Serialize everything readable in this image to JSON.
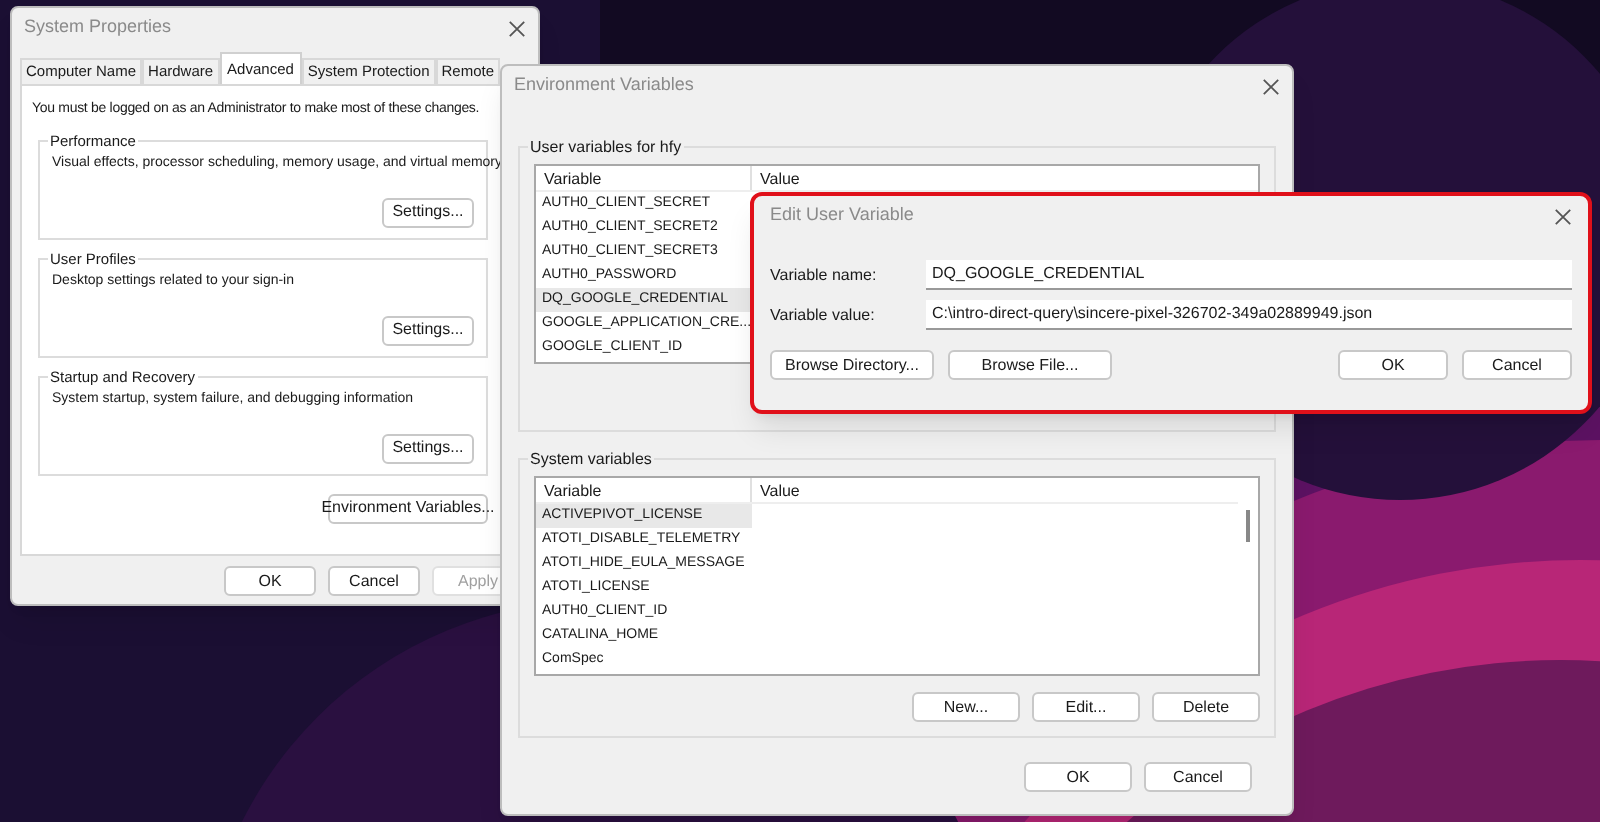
{
  "system_properties": {
    "title": "System Properties",
    "tabs": [
      {
        "label": "Computer Name",
        "selected": false
      },
      {
        "label": "Hardware",
        "selected": false
      },
      {
        "label": "Advanced",
        "selected": true
      },
      {
        "label": "System Protection",
        "selected": false
      },
      {
        "label": "Remote",
        "selected": false
      }
    ],
    "notice": "You must be logged on as an Administrator to make most of these changes.",
    "groups": [
      {
        "title": "Performance",
        "description": "Visual effects, processor scheduling, memory usage, and virtual memory",
        "button": "Settings..."
      },
      {
        "title": "User Profiles",
        "description": "Desktop settings related to your sign-in",
        "button": "Settings..."
      },
      {
        "title": "Startup and Recovery",
        "description": "System startup, system failure, and debugging information",
        "button": "Settings..."
      }
    ],
    "env_button": "Environment Variables...",
    "buttons": [
      {
        "label": "OK",
        "disabled": false
      },
      {
        "label": "Cancel",
        "disabled": false
      },
      {
        "label": "Apply",
        "disabled": true
      }
    ]
  },
  "environment_variables": {
    "title": "Environment Variables",
    "user_section": {
      "title": "User variables for hfy",
      "columns": [
        "Variable",
        "Value"
      ],
      "rows": [
        {
          "variable": "AUTH0_CLIENT_SECRET",
          "selected": false
        },
        {
          "variable": "AUTH0_CLIENT_SECRET2",
          "selected": false
        },
        {
          "variable": "AUTH0_CLIENT_SECRET3",
          "selected": false
        },
        {
          "variable": "AUTH0_PASSWORD",
          "selected": false
        },
        {
          "variable": "DQ_GOOGLE_CREDENTIAL",
          "selected": true
        },
        {
          "variable": "GOOGLE_APPLICATION_CRE...",
          "selected": false
        },
        {
          "variable": "GOOGLE_CLIENT_ID",
          "selected": false
        }
      ]
    },
    "system_section": {
      "title": "System variables",
      "columns": [
        "Variable",
        "Value"
      ],
      "rows": [
        {
          "variable": "ACTIVEPIVOT_LICENSE",
          "selected": true
        },
        {
          "variable": "ATOTI_DISABLE_TELEMETRY",
          "selected": false
        },
        {
          "variable": "ATOTI_HIDE_EULA_MESSAGE",
          "selected": false
        },
        {
          "variable": "ATOTI_LICENSE",
          "selected": false
        },
        {
          "variable": "AUTH0_CLIENT_ID",
          "selected": false
        },
        {
          "variable": "CATALINA_HOME",
          "selected": false
        },
        {
          "variable": "ComSpec",
          "selected": false
        }
      ],
      "buttons": [
        "New...",
        "Edit...",
        "Delete"
      ]
    },
    "buttons": [
      "OK",
      "Cancel"
    ]
  },
  "edit_dialog": {
    "title": "Edit User Variable",
    "highlighted": true,
    "fields": [
      {
        "label": "Variable name:",
        "value": "DQ_GOOGLE_CREDENTIAL"
      },
      {
        "label": "Variable value:",
        "value": "C:\\intro-direct-query\\sincere-pixel-326702-349a02889949.json"
      }
    ],
    "left_buttons": [
      "Browse Directory...",
      "Browse File..."
    ],
    "right_buttons": [
      "OK",
      "Cancel"
    ]
  }
}
